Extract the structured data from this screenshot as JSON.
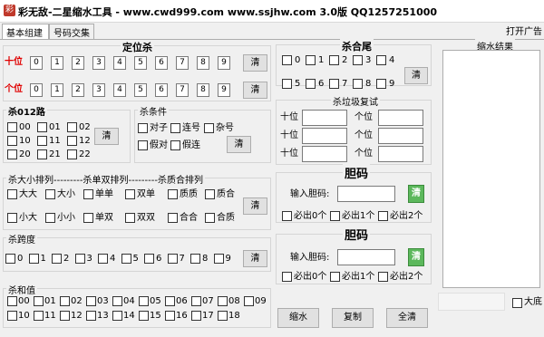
{
  "window": {
    "icon_char": "彩",
    "title": "彩无敌-二星缩水工具 - www.cwd999.com www.ssjhw.com 3.0版 QQ1257251000"
  },
  "tabs": [
    "基本组建",
    "号码交集"
  ],
  "ad_label": "打开广告",
  "digits": [
    "0",
    "1",
    "2",
    "3",
    "4",
    "5",
    "6",
    "7",
    "8",
    "9"
  ],
  "position": {
    "title": "定位杀",
    "tens_label": "十位",
    "units_label": "个位",
    "clear": "清"
  },
  "road012": {
    "title": "杀012路",
    "options": [
      "00",
      "01",
      "02",
      "10",
      "11",
      "12",
      "20",
      "21",
      "22"
    ],
    "clear": "清"
  },
  "kill_cond": {
    "title": "杀条件",
    "options": [
      "对子",
      "连号",
      "杂号",
      "假对",
      "假连"
    ],
    "clear": "清"
  },
  "arrangement": {
    "title": "杀大小排列---------杀单双排列---------杀质合排列",
    "row1": [
      "大大",
      "大小",
      "单单",
      "双单",
      "质质",
      "质合"
    ],
    "row2": [
      "小大",
      "小小",
      "单双",
      "双双",
      "合合",
      "合质"
    ],
    "clear": "清"
  },
  "span": {
    "title": "杀跨度",
    "clear": "清"
  },
  "sum": {
    "title": "杀和值",
    "row1": [
      "00",
      "01",
      "02",
      "03",
      "04",
      "05",
      "06",
      "07",
      "08",
      "09"
    ],
    "row2": [
      "10",
      "11",
      "12",
      "13",
      "14",
      "15",
      "16",
      "17",
      "18"
    ]
  },
  "tail": {
    "title": "杀合尾",
    "clear": "清"
  },
  "garbage": {
    "title": "杀垃圾复试",
    "tens_label": "十位",
    "units_label": "个位"
  },
  "courage1": {
    "title": "胆码",
    "input_label": "输入胆码:",
    "options": [
      "必出0个",
      "必出1个",
      "必出2个"
    ],
    "clear": "清"
  },
  "courage2": {
    "title": "胆码",
    "input_label": "输入胆码:",
    "options": [
      "必出0个",
      "必出1个",
      "必出2个"
    ],
    "clear": "清"
  },
  "result": {
    "title": "缩水结果"
  },
  "bottom": {
    "shrink": "缩水",
    "copy": "复制",
    "clear_all": "全清",
    "big_font": "大底"
  }
}
